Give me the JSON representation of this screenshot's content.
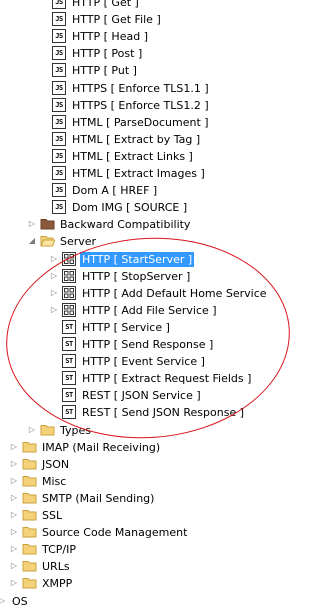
{
  "tree": {
    "rows": [
      {
        "label": "HTTP [ Get ]",
        "icon": "js",
        "indent": 1
      },
      {
        "label": "HTTP [ Get File ]",
        "icon": "js",
        "indent": 1
      },
      {
        "label": "HTTP [ Head ]",
        "icon": "js",
        "indent": 1
      },
      {
        "label": "HTTP [ Post ]",
        "icon": "js",
        "indent": 1
      },
      {
        "label": "HTTP [ Put ]",
        "icon": "js",
        "indent": 1
      },
      {
        "label": "HTTPS [ Enforce TLS1.1 ]",
        "icon": "js",
        "indent": 1
      },
      {
        "label": "HTTPS [ Enforce TLS1.2 ]",
        "icon": "js",
        "indent": 1
      },
      {
        "label": "HTML [ ParseDocument ]",
        "icon": "js",
        "indent": 1
      },
      {
        "label": "HTML [ Extract by Tag ]",
        "icon": "js",
        "indent": 1
      },
      {
        "label": "HTML [ Extract Links ]",
        "icon": "js",
        "indent": 1
      },
      {
        "label": "HTML [ Extract Images ]",
        "icon": "js",
        "indent": 1
      },
      {
        "label": "Dom A  [ HREF ]",
        "icon": "js",
        "indent": 1
      },
      {
        "label": "Dom IMG [ SOURCE ]",
        "icon": "js",
        "indent": 1
      },
      {
        "label": "Backward Compatibility",
        "icon": "folder-brown",
        "indent": 0,
        "expander": "collapsed"
      },
      {
        "label": "Server",
        "icon": "folder-open",
        "indent": 0,
        "expander": "expanded"
      },
      {
        "label": "HTTP [ StartServer ]",
        "icon": "grid",
        "indent": 2,
        "expander": "collapsed",
        "selected": true
      },
      {
        "label": "HTTP [ StopServer ]",
        "icon": "grid",
        "indent": 2,
        "expander": "collapsed"
      },
      {
        "label": "HTTP [ Add Default Home Service",
        "icon": "grid",
        "indent": 2,
        "expander": "collapsed"
      },
      {
        "label": "HTTP [ Add File Service ]",
        "icon": "grid",
        "indent": 2,
        "expander": "collapsed"
      },
      {
        "label": "HTTP [ Service ]",
        "icon": "st",
        "indent": 2
      },
      {
        "label": "HTTP [ Send Response ]",
        "icon": "st",
        "indent": 2
      },
      {
        "label": "HTTP [ Event Service ]",
        "icon": "st",
        "indent": 2
      },
      {
        "label": "HTTP [ Extract Request Fields ]",
        "icon": "st",
        "indent": 2
      },
      {
        "label": "REST [ JSON Service ]",
        "icon": "st",
        "indent": 2
      },
      {
        "label": "REST [ Send JSON Response ]",
        "icon": "st",
        "indent": 2
      },
      {
        "label": "Types",
        "icon": "folder",
        "indent": 0,
        "expander": "collapsed"
      },
      {
        "label": "IMAP (Mail Receiving)",
        "icon": "folder",
        "indent": -1,
        "expander": "collapsed"
      },
      {
        "label": "JSON",
        "icon": "folder",
        "indent": -1,
        "expander": "collapsed"
      },
      {
        "label": "Misc",
        "icon": "folder",
        "indent": -1,
        "expander": "collapsed"
      },
      {
        "label": "SMTP (Mail Sending)",
        "icon": "folder",
        "indent": -1,
        "expander": "collapsed"
      },
      {
        "label": "SSL",
        "icon": "folder",
        "indent": -1,
        "expander": "collapsed"
      },
      {
        "label": "Source Code Management",
        "icon": "folder",
        "indent": -1,
        "expander": "collapsed"
      },
      {
        "label": "TCP/IP",
        "icon": "folder",
        "indent": -1,
        "expander": "collapsed"
      },
      {
        "label": "URLs",
        "icon": "folder",
        "indent": -1,
        "expander": "collapsed"
      },
      {
        "label": "XMPP",
        "icon": "folder",
        "indent": -1,
        "expander": "collapsed"
      },
      {
        "label": "OS",
        "icon": "none",
        "indent": -2,
        "expander": "collapsed"
      }
    ]
  },
  "colors": {
    "selection": "#3399ff",
    "annotation": "#d9141b",
    "folder": "#f5d27a",
    "folder_brown": "#8b5a3c"
  }
}
